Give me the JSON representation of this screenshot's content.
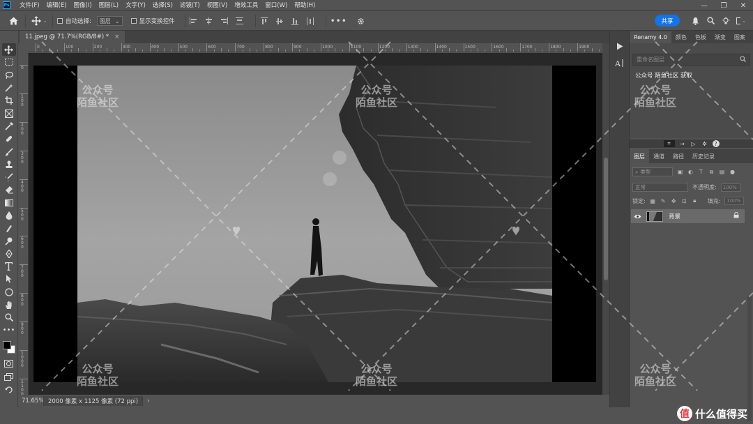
{
  "menubar": {
    "app_icon": "Ps",
    "items": [
      {
        "label": "文件(F)"
      },
      {
        "label": "编辑(E)"
      },
      {
        "label": "图像(I)"
      },
      {
        "label": "图层(L)"
      },
      {
        "label": "文字(Y)"
      },
      {
        "label": "选择(S)"
      },
      {
        "label": "滤镜(T)"
      },
      {
        "label": "视图(V)"
      },
      {
        "label": "增效工具"
      },
      {
        "label": "窗口(W)"
      },
      {
        "label": "帮助(H)"
      }
    ],
    "window_controls": {
      "minimize": "—",
      "restore": "❐",
      "close": "✕"
    }
  },
  "optbar": {
    "auto_select_label": "自动选择:",
    "auto_select_value": "图层",
    "show_transform_label": "显示变换控件",
    "more": "•••",
    "share_label": "共享"
  },
  "document": {
    "tab_title": "11.jpeg @ 71.7%(RGB/8#) *",
    "close": "×"
  },
  "ruler": {
    "top_labels": [
      "0",
      "100",
      "200",
      "300",
      "400",
      "500",
      "600",
      "700",
      "800",
      "900",
      "1000",
      "1100",
      "1200",
      "1300",
      "1400",
      "1500",
      "1600",
      "1700",
      "1800",
      "1900"
    ],
    "left_labels": [
      "0",
      "100",
      "200",
      "300",
      "400",
      "500",
      "600",
      "700",
      "800",
      "900",
      "1000",
      "1100"
    ]
  },
  "status": {
    "zoom": "71.65%",
    "info": "2000 像素 x 1125 像素 (72 ppi)",
    "arrow": "›"
  },
  "panels": {
    "top_tabs": [
      "Renamy 4.0",
      "颜色",
      "色板",
      "渐变",
      "图案"
    ],
    "renamy_search_placeholder": "重命名图层",
    "renamy_item": "公众号 陌鱼社区 获取",
    "layer_tabs": [
      "图层",
      "通道",
      "路径",
      "历史记录"
    ],
    "filter_label": "类型",
    "blend_mode": "正常",
    "opacity_label": "不透明度:",
    "opacity_value": "100%",
    "lock_label": "锁定:",
    "fill_label": "填充:",
    "fill_value": "100%",
    "layer_name": "背景"
  },
  "watermark": {
    "line1": "公众号",
    "line2": "陌鱼社区",
    "site_badge": "值",
    "site_text": "什么值得买"
  },
  "colors": {
    "accent": "#1473e6",
    "panel_bg": "#535353",
    "canvas_bg": "#282828"
  }
}
